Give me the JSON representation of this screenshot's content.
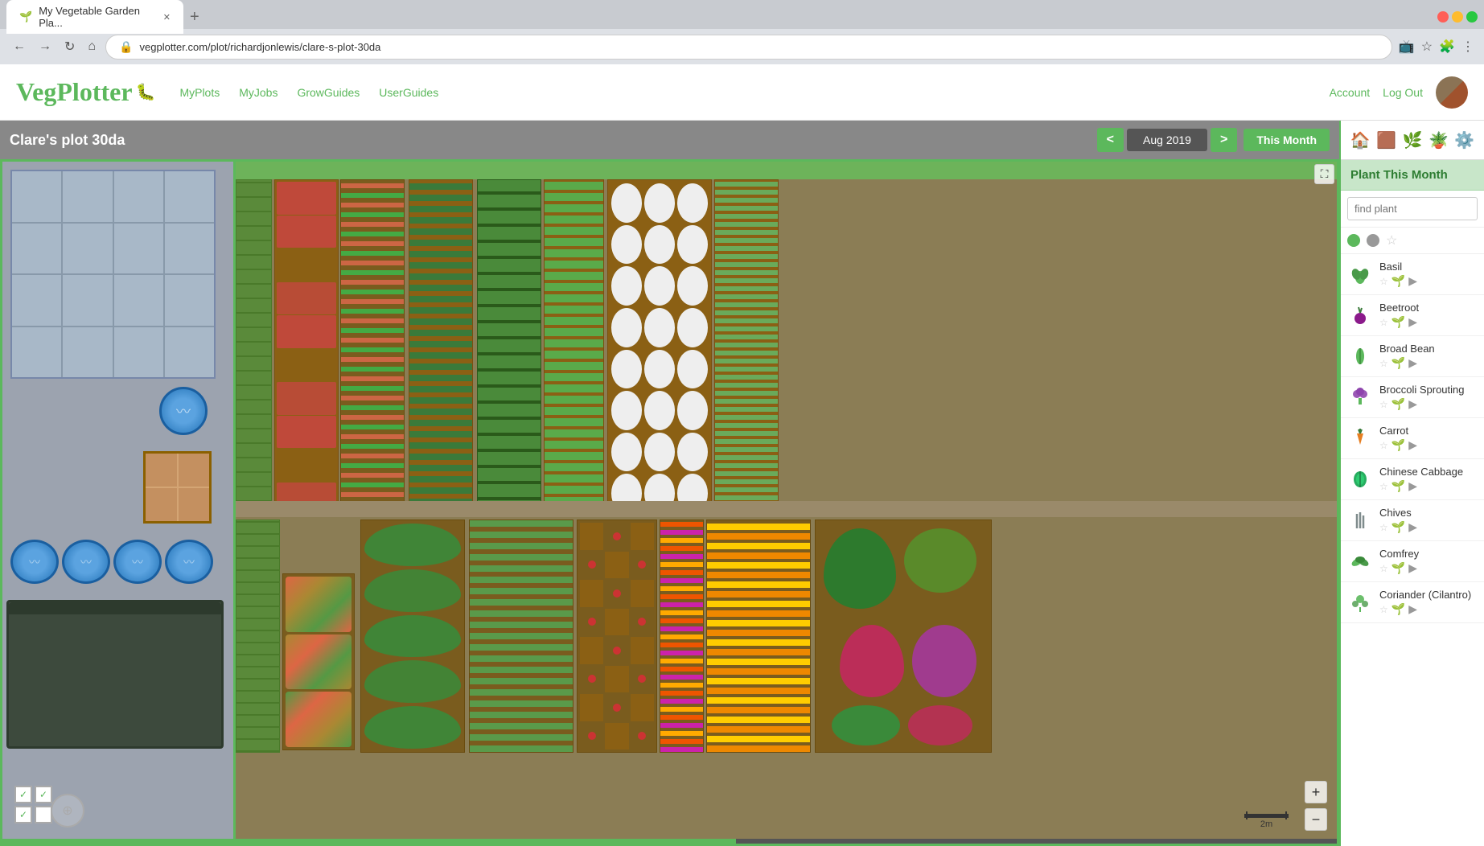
{
  "browser": {
    "tab_title": "My Vegetable Garden Pla...",
    "url": "vegplotter.com/plot/richardjonlewis/clare-s-plot-30da",
    "favicon": "🌱"
  },
  "header": {
    "logo": "VegPlotter",
    "nav": [
      "MyPlots",
      "MyJobs",
      "GrowGuides",
      "UserGuides"
    ],
    "account_link": "Account",
    "logout_link": "Log Out"
  },
  "garden": {
    "title": "Clare's plot 30da",
    "month": "Aug 2019",
    "this_month_label": "This Month",
    "prev_label": "<",
    "next_label": ">"
  },
  "right_panel": {
    "header": "Plant This Month",
    "search_placeholder": "find plant",
    "filters": {
      "green_dot": "green",
      "gray_dot": "gray",
      "star": "☆"
    },
    "plants": [
      {
        "name": "Basil",
        "icon_color": "#5cb85c",
        "icon_type": "herb"
      },
      {
        "name": "Beetroot",
        "icon_color": "#8b1a8b",
        "icon_type": "root"
      },
      {
        "name": "Broad Bean",
        "icon_color": "#5cb85c",
        "icon_type": "bean"
      },
      {
        "name": "Broccoli Sprouting",
        "icon_color": "#9b59b6",
        "icon_type": "brassica"
      },
      {
        "name": "Carrot",
        "icon_color": "#e67e22",
        "icon_type": "root"
      },
      {
        "name": "Chinese Cabbage",
        "icon_color": "#27ae60",
        "icon_type": "brassica"
      },
      {
        "name": "Chives",
        "icon_color": "#7f8c8d",
        "icon_type": "herb"
      },
      {
        "name": "Comfrey",
        "icon_color": "#5cb85c",
        "icon_type": "herb"
      },
      {
        "name": "Coriander (Cilantro)",
        "icon_color": "#5cb85c",
        "icon_type": "herb"
      }
    ]
  },
  "tool_icons": {
    "home": "🏠",
    "settings_alt": "🌿",
    "plant": "🌱",
    "pot": "🪴",
    "gear": "⚙️"
  },
  "scale": "2m",
  "zoom_in": "+",
  "zoom_out": "−"
}
